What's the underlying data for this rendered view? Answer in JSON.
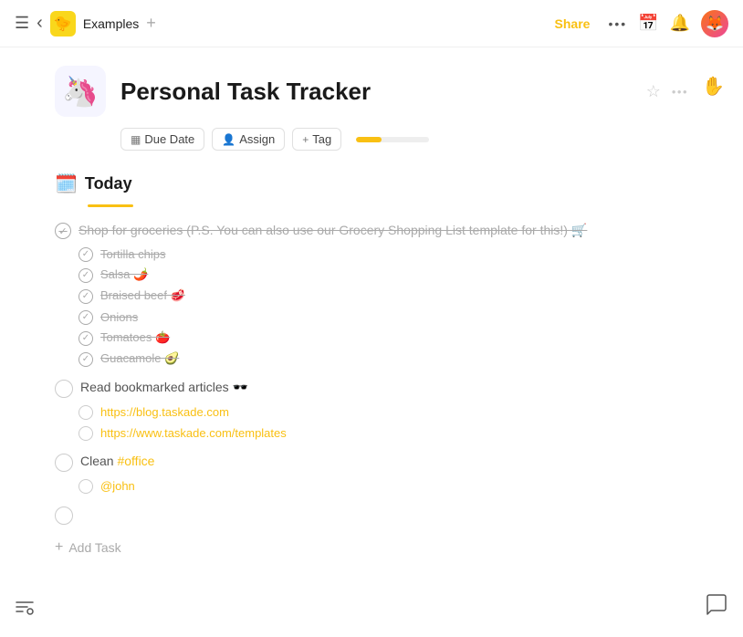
{
  "topNav": {
    "menuIcon": "☰",
    "backIcon": "‹",
    "workspaceEmoji": "🐤",
    "workspaceName": "Examples",
    "addIcon": "+",
    "shareLabel": "Share",
    "moreIcon": "•••",
    "calendarIcon": "📅",
    "bellIcon": "🔔",
    "avatarEmoji": "🦊"
  },
  "page": {
    "emoji": "🦄",
    "title": "Personal Task Tracker",
    "starIcon": "☆",
    "moreIcon": "•••"
  },
  "toolbar": {
    "dueDateLabel": "Due Date",
    "assignLabel": "Assign",
    "tagLabel": "Tag",
    "progressPercent": 35
  },
  "section": {
    "emoji": "📅",
    "emojiAlt": "🗓️",
    "title": "Today"
  },
  "tasks": [
    {
      "id": "t1",
      "text": "Shop for groceries (P.S. You can also use our Grocery Shopping List template for this!) 🛒",
      "completed": true,
      "subtasks": [
        {
          "id": "s1",
          "text": "Tortilla chips",
          "completed": true
        },
        {
          "id": "s2",
          "text": "Salsa 🌶️",
          "completed": true
        },
        {
          "id": "s3",
          "text": "Braised beef 🥩",
          "completed": true
        },
        {
          "id": "s4",
          "text": "Onions",
          "completed": true
        },
        {
          "id": "s5",
          "text": "Tomatoes 🍅",
          "completed": true
        },
        {
          "id": "s6",
          "text": "Guacamole 🥑",
          "completed": true
        }
      ]
    },
    {
      "id": "t2",
      "text": "Read bookmarked articles 🕶️",
      "completed": false,
      "subtasks": [
        {
          "id": "s7",
          "text": "https://blog.taskade.com",
          "completed": false,
          "isLink": true
        },
        {
          "id": "s8",
          "text": "https://www.taskade.com/templates",
          "completed": false,
          "isLink": true
        }
      ]
    },
    {
      "id": "t3",
      "text": "Clean",
      "completed": false,
      "hashtag": "#office",
      "subtasks": [
        {
          "id": "s9",
          "text": "@john",
          "completed": false,
          "isMention": true
        }
      ]
    },
    {
      "id": "t4",
      "text": "",
      "completed": false,
      "subtasks": []
    }
  ],
  "addTaskLabel": "Add Task",
  "handCursor": "✋",
  "filterIcon": "≡",
  "chatIcon": "💬"
}
